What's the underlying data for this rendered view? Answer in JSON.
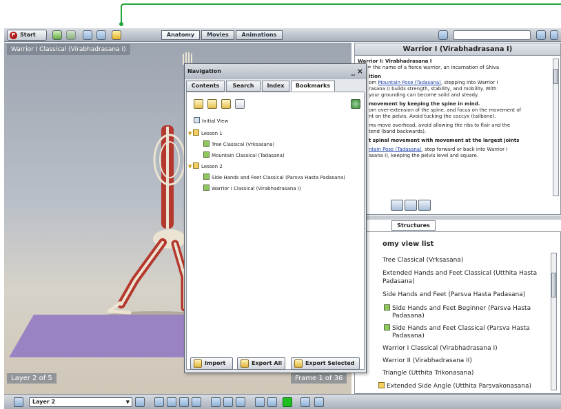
{
  "toolbar": {
    "start_label": "Start",
    "start_logo": "P",
    "tabs": [
      "Anatomy",
      "Movies",
      "Animations"
    ]
  },
  "viewer": {
    "title": "Warrior I Classical (Virabhadrasana I)",
    "layer_readout": "Layer 2 of 5",
    "frame_readout": "Frame 1 of 36"
  },
  "navigation": {
    "title": "Navigation",
    "minimize": "_",
    "close": "×",
    "tabs": [
      "Contents",
      "Search",
      "Index",
      "Bookmarks"
    ],
    "tree": {
      "initial_view": "Initial View",
      "lesson1": "Lesson 1",
      "lesson1_items": [
        "Tree Classical (Vrksasana)",
        "Mountain Classical (Tadasana)"
      ],
      "lesson2": "Lesson 2",
      "lesson2_items": [
        "Side Hands and Feet Classical (Parsva Hasta Padasana)",
        "Warrior I Classical (Virabhadrasana I)"
      ]
    },
    "buttons": {
      "import": "Import",
      "export_all": "Export All",
      "export_selected": "Export Selected"
    }
  },
  "info": {
    "title": "Warrior I (Virabhadrasana I)",
    "heading": "Warrior I: Virabhadrasana I",
    "l1": "= the name of a fierce warrior, an incarnation of Shiva",
    "s1": "ition",
    "l2a": "om",
    "l2_link": "Mountain Pose (Tadasana)",
    "l2b": ", stepping into Warrior I",
    "l3": "rasana I) builds strength, stability, and mobility. With",
    "l4": "your grounding can become solid and steady.",
    "s2": "movement by keeping the spine in mind.",
    "l5": "om over-extension of the spine, and focus on the movement of",
    "l6": "nt on the pelvis. Avoid tucking the coccyx (tailbone).",
    "l7": "ms move overhead, avoid allowing the ribs to flair and the",
    "l8": "tend (band backwards).",
    "s3": "t spinal movement with movement at the largest joints",
    "l9_link": "ntain Pose (Tadasana)",
    "l9b": ", step forward or back into Warrior I",
    "l10": "asana I), keeping the pelvis level and square."
  },
  "structures_tab": "Structures",
  "list": {
    "heading": "omy view list",
    "items": [
      "Tree Classical (Vrksasana)",
      "Extended Hands and Feet Classical (Utthita Hasta",
      "Padasana)",
      "Side Hands and Feet (Parsva Hasta Padasana)",
      "Side Hands and Feet Beginner (Parsva Hasta",
      "Padasana)",
      "Side Hands and Feet Classical (Parsva Hasta",
      "Padasana)",
      "Warrior I Classical (Virabhadrasana I)",
      "Warrior II (Virabhadrasana II)",
      "Triangle (Utthita Trikonasana)",
      "Extended Side Angle (Utthita Parsvakonasana)"
    ]
  },
  "bottom": {
    "layer_select": "Layer 2",
    "caret": "▼"
  },
  "colors": {
    "callout": "#22a63a",
    "mat": "#9a83c2",
    "muscle": "#b5382e",
    "bone": "#ece4d2"
  }
}
